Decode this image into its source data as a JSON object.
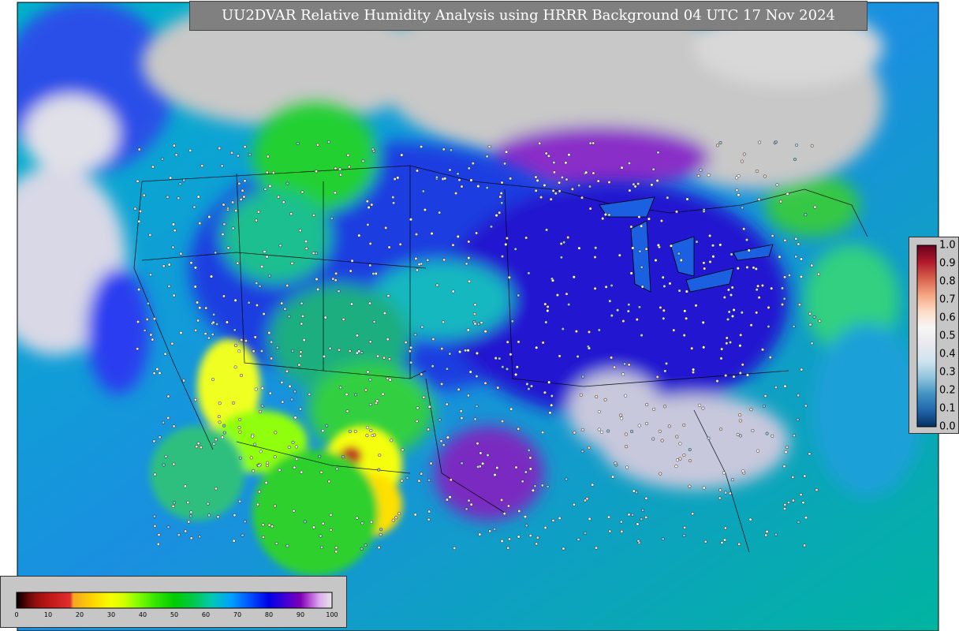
{
  "title": "UU2DVAR Relative Humidity Analysis using HRRR Background 04 UTC 17 Nov 2024",
  "rh_colorbar": {
    "tick_labels": [
      "0",
      "10",
      "20",
      "30",
      "40",
      "50",
      "60",
      "70",
      "80",
      "90",
      "100"
    ],
    "stops": [
      {
        "v": 0,
        "c": "#000000"
      },
      {
        "v": 2,
        "c": "#3a0000"
      },
      {
        "v": 4,
        "c": "#6a0a0a"
      },
      {
        "v": 7,
        "c": "#a01010"
      },
      {
        "v": 12,
        "c": "#c81c1c"
      },
      {
        "v": 17,
        "c": "#e03030"
      },
      {
        "v": 18,
        "c": "#f5a623"
      },
      {
        "v": 24,
        "c": "#ffd400"
      },
      {
        "v": 30,
        "c": "#f5ff00"
      },
      {
        "v": 34,
        "c": "#d4ff00"
      },
      {
        "v": 38,
        "c": "#8cff00"
      },
      {
        "v": 44,
        "c": "#33e600"
      },
      {
        "v": 50,
        "c": "#00cc00"
      },
      {
        "v": 56,
        "c": "#00c84a"
      },
      {
        "v": 62,
        "c": "#00c8b4"
      },
      {
        "v": 68,
        "c": "#00a0ff"
      },
      {
        "v": 74,
        "c": "#0050ff"
      },
      {
        "v": 80,
        "c": "#0000e6"
      },
      {
        "v": 86,
        "c": "#4b00d2"
      },
      {
        "v": 90,
        "c": "#7d00b4"
      },
      {
        "v": 93,
        "c": "#b450d2"
      },
      {
        "v": 96,
        "c": "#dcaaf0"
      },
      {
        "v": 100,
        "c": "#e6e6e6"
      }
    ]
  },
  "increment_colorbar": {
    "labels": [
      "1.0",
      "0.9",
      "0.8",
      "0.7",
      "0.6",
      "0.5",
      "0.4",
      "0.3",
      "0.2",
      "0.1",
      "0.0"
    ],
    "colors": [
      "#67001f",
      "#b2182b",
      "#d6604d",
      "#f4a582",
      "#fddbc7",
      "#f7f7f7",
      "#e8e8ee",
      "#d1e5f0",
      "#92c5de",
      "#4393c3",
      "#2166ac",
      "#053061"
    ]
  },
  "colors": {
    "ocean": "#1fa5c8",
    "land_low": "#2030d8",
    "dry_sw": "#f0ff20",
    "moist_north": "#c8c8c8",
    "border": "#000000"
  }
}
